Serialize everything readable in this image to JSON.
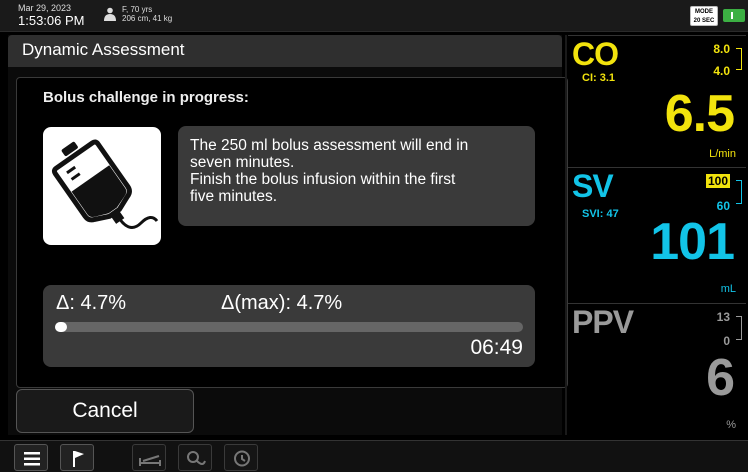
{
  "topbar": {
    "date": "Mar 29, 2023",
    "time": "1:53:06 PM",
    "patient_line1": "F, 70 yrs",
    "patient_line2": "206 cm, 41 kg",
    "mode_line1": "MODE",
    "mode_line2": "20 SEC",
    "icons": [
      "patient-icon",
      "battery-icon"
    ]
  },
  "dialog": {
    "title": "Dynamic Assessment",
    "status": "Bolus challenge in progress:",
    "message_line1": "The 250 ml bolus assessment will end in",
    "message_line2": "seven minutes.",
    "message_line3": "Finish the bolus infusion within the first",
    "message_line4": "five minutes.",
    "delta_label": "Δ: 4.7%",
    "delta_max_label": "Δ(max): 4.7%",
    "progress_fraction": 0.02,
    "timer": "06:49",
    "cancel_label": "Cancel",
    "bag_icon": "iv-bag-icon"
  },
  "parameters": {
    "co": {
      "name": "CO",
      "sub": "CI: 3.1",
      "target_high": "8.0",
      "target_low": "4.0",
      "value": "6.5",
      "unit": "L/min",
      "color": "#f2e30d"
    },
    "sv": {
      "name": "SV",
      "sub": "SVI: 47",
      "target_high": "100",
      "target_low": "60",
      "value": "101",
      "unit": "mL",
      "color": "#12c4e8"
    },
    "ppv": {
      "name": "PPV",
      "target_high": "13",
      "target_low": "0",
      "value": "6",
      "unit": "%",
      "color": "#9a9a9a"
    }
  },
  "toolbar": {
    "buttons": [
      "menu-icon",
      "flag-icon",
      "bed-icon",
      "probe-icon",
      "history-icon"
    ]
  }
}
